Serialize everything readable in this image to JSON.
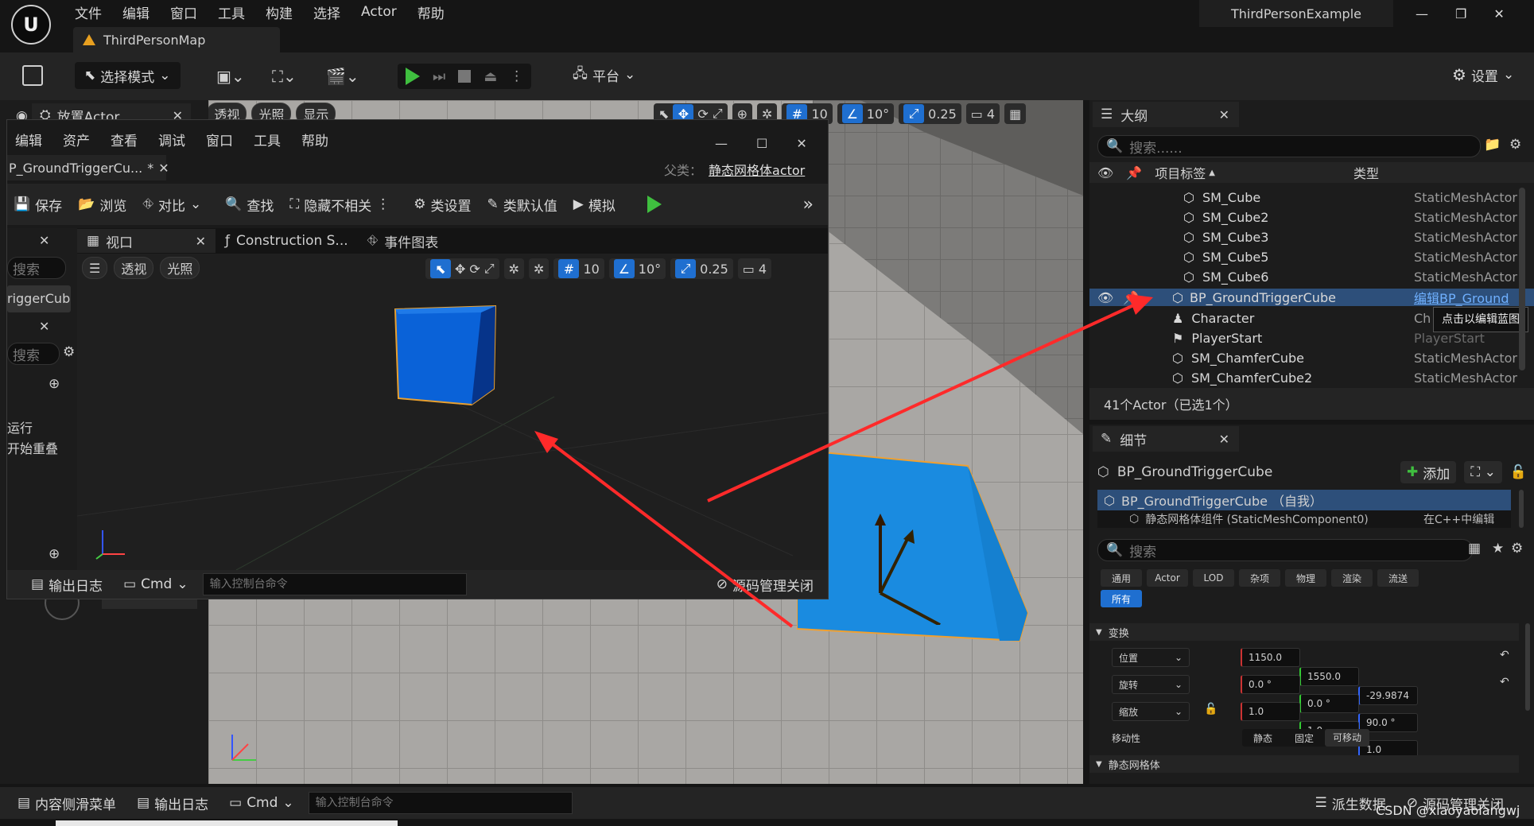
{
  "app": {
    "menu": [
      "文件",
      "编辑",
      "窗口",
      "工具",
      "构建",
      "选择",
      "Actor",
      "帮助"
    ],
    "project_name": "ThirdPersonExample",
    "map_tab": "ThirdPersonMap",
    "mode_label": "选择模式",
    "platform_label": "平台",
    "settings_label": "设置"
  },
  "place_actor": {
    "title": "放置Actor"
  },
  "viewport_toolbar": {
    "perspective": "透视",
    "lighting": "光照",
    "show": "显示",
    "grid_snap": "10",
    "rot_snap": "10°",
    "scale_snap": "0.25",
    "camera_speed": "4"
  },
  "blueprint": {
    "menu": [
      "编辑",
      "资产",
      "查看",
      "调试",
      "窗口",
      "工具",
      "帮助"
    ],
    "tab_title": "P_GroundTriggerCu...",
    "tab_dirty": "*",
    "parent_label": "父类：",
    "parent_value": "静态网格体actor",
    "toolbar": {
      "save": "保存",
      "browse": "浏览",
      "diff": "对比",
      "find": "查找",
      "hide_unrelated": "隐藏不相关",
      "class_settings": "类设置",
      "class_defaults": "类默认值",
      "simulate": "模拟"
    },
    "tabs": {
      "viewport": "视口",
      "construction": "Construction S...",
      "event_graph": "事件图表"
    },
    "viewport": {
      "perspective": "透视",
      "lighting": "光照",
      "grid_snap": "10",
      "rot_snap": "10°",
      "scale_snap": "0.25",
      "camera_speed": "4"
    },
    "left_panel": {
      "search_placeholder": "搜索",
      "component_item": "riggerCub",
      "search2_placeholder": "搜索",
      "event_run": "运行",
      "event_overlap": "开始重叠"
    },
    "bottom": {
      "output_log": "输出日志",
      "cmd": "Cmd",
      "console_placeholder": "输入控制台命令",
      "source_control": "源码管理关闭"
    }
  },
  "outliner": {
    "title": "大纲",
    "search_placeholder": "搜索......",
    "col_label": "项目标签",
    "col_type": "类型",
    "items": [
      {
        "name": "SM_Cube",
        "type": "StaticMeshActor"
      },
      {
        "name": "SM_Cube2",
        "type": "StaticMeshActor"
      },
      {
        "name": "SM_Cube3",
        "type": "StaticMeshActor"
      },
      {
        "name": "SM_Cube5",
        "type": "StaticMeshActor"
      },
      {
        "name": "SM_Cube6",
        "type": "StaticMeshActor"
      },
      {
        "name": "BP_GroundTriggerCube",
        "type": "编辑BP_Ground"
      },
      {
        "name": "Character",
        "type": "Ch"
      },
      {
        "name": "PlayerStart",
        "type": "PlayerStart"
      },
      {
        "name": "SM_ChamferCube",
        "type": "StaticMeshActor"
      },
      {
        "name": "SM_ChamferCube2",
        "type": "StaticMeshActor"
      }
    ],
    "tooltip": "点击以编辑蓝图",
    "status": "41个Actor（已选1个）"
  },
  "details": {
    "title": "细节",
    "actor_name": "BP_GroundTriggerCube",
    "add_label": "添加",
    "self_row": "BP_GroundTriggerCube （自我）",
    "component_row": "静态网格体组件 (StaticMeshComponent0)",
    "component_row_right": "在C++中编辑",
    "search_placeholder": "搜索",
    "categories": [
      "通用",
      "Actor",
      "LOD",
      "杂项",
      "物理",
      "渲染",
      "流送"
    ],
    "all_label": "所有",
    "transform_section": "变换",
    "location_label": "位置",
    "location": [
      "1150.0",
      "1550.0",
      "-29.9874"
    ],
    "rotation_label": "旋转",
    "rotation": [
      "0.0 °",
      "0.0 °",
      "90.0 °"
    ],
    "scale_label": "缩放",
    "scale": [
      "1.0",
      "1.0",
      "1.0"
    ],
    "mobility_label": "移动性",
    "mobility_options": [
      "静态",
      "固定",
      "可移动"
    ],
    "static_mesh_section": "静态网格体"
  },
  "statusbar": {
    "content_drawer": "内容侧滑菜单",
    "output_log": "输出日志",
    "cmd": "Cmd",
    "console_placeholder": "输入控制台命令",
    "derived_data": "派生数据",
    "source_control": "源码管理关闭",
    "watermark": "CSDN @xiaoyaolangwj"
  },
  "colors": {
    "accent_blue": "#1f6fd0",
    "selection": "#2d4f7a",
    "play_green": "#3fbf3f",
    "arrow_red": "#ff2a2a",
    "cube_blue": "#0d6fe0"
  }
}
